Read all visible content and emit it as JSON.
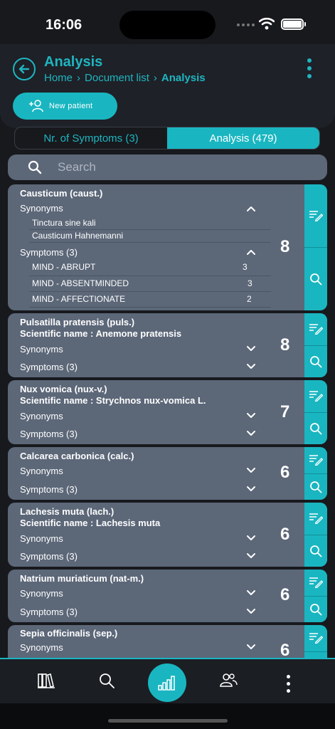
{
  "status": {
    "time": "16:06"
  },
  "header": {
    "title": "Analysis",
    "breadcrumb": [
      "Home",
      "Document list",
      "Analysis"
    ],
    "new_patient_label": "New patient"
  },
  "tabs": [
    {
      "label": "Nr. of Symptoms (3)",
      "active": false
    },
    {
      "label": "Analysis (479)",
      "active": true
    }
  ],
  "search": {
    "placeholder": "Search"
  },
  "remedies": [
    {
      "name": "Causticum (caust.)",
      "scientific": "",
      "score": "8",
      "synonyms_label": "Synonyms",
      "symptoms_label": "Symptoms (3)",
      "synonyms": [
        "Tinctura sine kali",
        "Causticum Hahnemanni"
      ],
      "symptoms": [
        {
          "text": "MIND - ABRUPT",
          "value": "3"
        },
        {
          "text": "MIND - ABSENTMINDED",
          "value": "3"
        },
        {
          "text": "MIND - AFFECTIONATE",
          "value": "2"
        }
      ]
    },
    {
      "name": "Pulsatilla pratensis (puls.)",
      "scientific": "Scientific name : Anemone pratensis",
      "score": "8",
      "synonyms_label": "Synonyms",
      "symptoms_label": "Symptoms (3)"
    },
    {
      "name": "Nux vomica (nux-v.)",
      "scientific": "Scientific name : Strychnos nux-vomica L.",
      "score": "7",
      "synonyms_label": "Synonyms",
      "symptoms_label": "Symptoms (3)"
    },
    {
      "name": "Calcarea carbonica (calc.)",
      "scientific": "",
      "score": "6",
      "synonyms_label": "Synonyms",
      "symptoms_label": "Symptoms (3)"
    },
    {
      "name": "Lachesis muta (lach.)",
      "scientific": "Scientific name : Lachesis muta",
      "score": "6",
      "synonyms_label": "Synonyms",
      "symptoms_label": "Symptoms (3)"
    },
    {
      "name": "Natrium muriaticum (nat-m.)",
      "scientific": "",
      "score": "6",
      "synonyms_label": "Synonyms",
      "symptoms_label": "Symptoms (3)"
    },
    {
      "name": "Sepia officinalis (sep.)",
      "scientific": "",
      "score": "6",
      "synonyms_label": "Synonyms",
      "symptoms_label": ""
    }
  ],
  "colors": {
    "accent": "#19b6c1",
    "card": "#5c6778",
    "background": "#17191d"
  },
  "bottom_nav": [
    "library-icon",
    "search-icon",
    "analysis-icon",
    "patients-icon",
    "more-icon"
  ]
}
